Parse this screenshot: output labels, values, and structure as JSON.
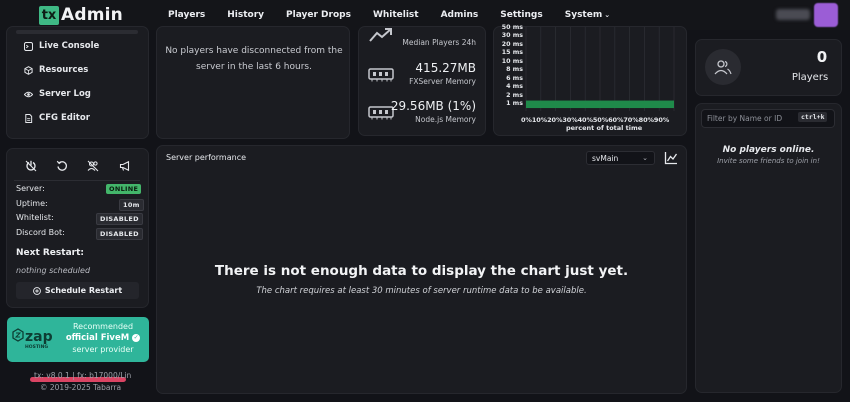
{
  "app": {
    "logo_mark": "tx",
    "logo_text": "Admin"
  },
  "nav": {
    "items": [
      "Players",
      "History",
      "Player Drops",
      "Whitelist",
      "Admins",
      "Settings"
    ],
    "system_label": "System"
  },
  "menu": {
    "items": [
      {
        "label": "Live Console",
        "icon": "terminal-icon"
      },
      {
        "label": "Resources",
        "icon": "cube-icon"
      },
      {
        "label": "Server Log",
        "icon": "eye-icon"
      },
      {
        "label": "CFG Editor",
        "icon": "file-icon"
      }
    ]
  },
  "controls": {
    "stats": [
      {
        "label": "Server:",
        "value": "ONLINE",
        "status": "online"
      },
      {
        "label": "Uptime:",
        "value": "10m",
        "status": "neutral"
      },
      {
        "label": "Whitelist:",
        "value": "DISABLED",
        "status": "neutral"
      },
      {
        "label": "Discord Bot:",
        "value": "DISABLED",
        "status": "neutral"
      }
    ],
    "next_restart_title": "Next Restart:",
    "next_restart_value": "nothing scheduled",
    "schedule_button": "Schedule Restart"
  },
  "ad": {
    "line1": "Recommended",
    "line2": "official FiveM",
    "line3": "server provider",
    "logo_word": "zap",
    "logo_sub": "HOSTING"
  },
  "footer": {
    "version": "tx: v8.0.1 | fx: b17000/Lin",
    "copyright": "© 2019-2025 Tabarra"
  },
  "disconnected": {
    "message": "No players have disconnected from the server in the last 6 hours."
  },
  "metrics": {
    "median_label": "Median Players 24h",
    "fxserver_value": "415.27MB",
    "fxserver_label": "FXServer Memory",
    "node_value": "29.56MB (1%)",
    "node_label": "Node.js Memory"
  },
  "chart_data": {
    "type": "heatmap",
    "y_ticks": [
      "50 ms",
      "30 ms",
      "20 ms",
      "15 ms",
      "10 ms",
      "8 ms",
      "6 ms",
      "4 ms",
      "2 ms",
      "1 ms"
    ],
    "x_ticks": [
      "0%",
      "10%",
      "20%",
      "30%",
      "40%",
      "50%",
      "60%",
      "70%",
      "80%",
      "90%"
    ],
    "xlabel": "percent of total time",
    "series": [
      {
        "bucket": "1 ms",
        "percent": 100
      }
    ],
    "colors": {
      "fill": "#1f8a4a"
    }
  },
  "players": {
    "count": "0",
    "label": "Players",
    "search_placeholder": "Filter by Name or ID",
    "shortcut": "ctrl+k",
    "empty_title": "No players online.",
    "empty_sub": "Invite some friends to join in!"
  },
  "performance": {
    "title": "Server performance",
    "thread": "svMain",
    "message": "There is not enough data to display the chart just yet.",
    "sub": "The chart requires at least 30 minutes of server runtime data to be available."
  },
  "colors": {
    "accent": "#3fb985",
    "online": "#43b56a",
    "ad": "#2fb59a",
    "highlight": "#ef4a6b"
  }
}
